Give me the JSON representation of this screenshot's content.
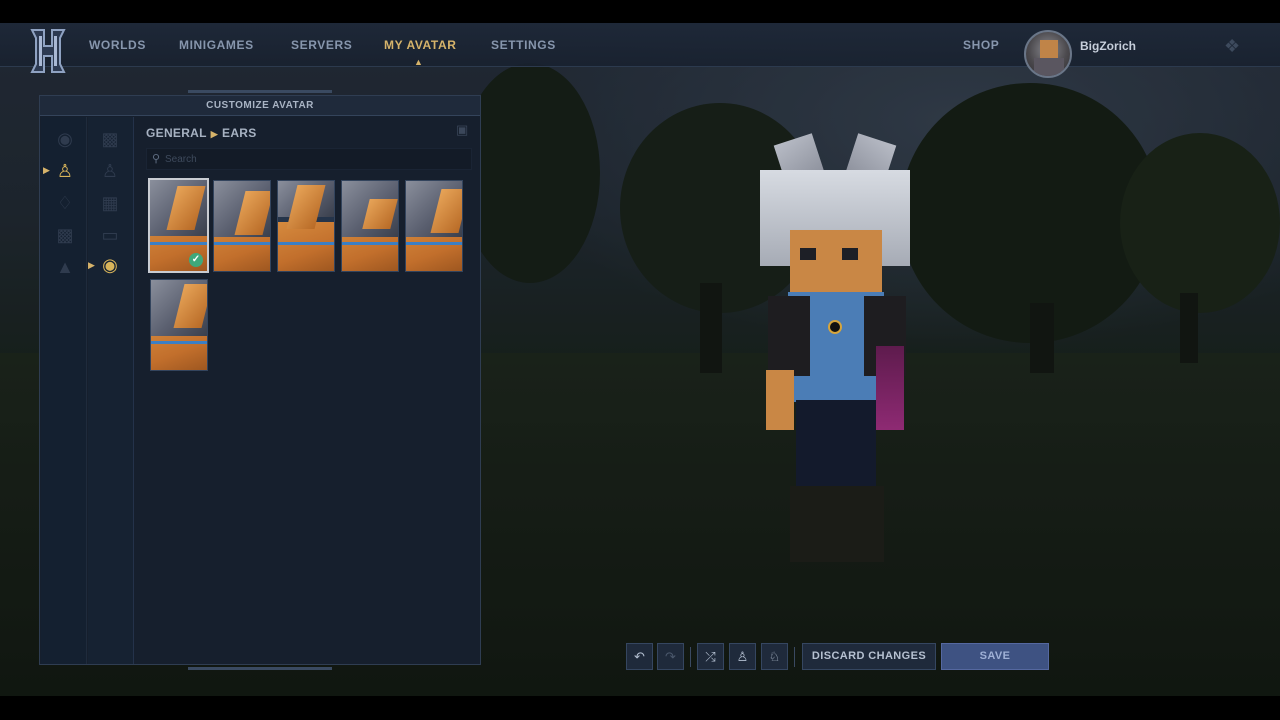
{
  "nav": {
    "items": [
      {
        "label": "WORLDS",
        "active": false
      },
      {
        "label": "MINIGAMES",
        "active": false
      },
      {
        "label": "SERVERS",
        "active": false
      },
      {
        "label": "MY AVATAR",
        "active": true
      },
      {
        "label": "SETTINGS",
        "active": false
      }
    ],
    "shop_label": "SHOP",
    "username": "BigZorich",
    "logo_icon": "hytale-h-logo",
    "accent_color": "#d6b36a"
  },
  "panel": {
    "title": "CUSTOMIZE AVATAR",
    "breadcrumb": {
      "parent": "GENERAL",
      "current": "EARS"
    },
    "search": {
      "placeholder": "Search",
      "value": ""
    },
    "categories_col1": [
      {
        "icon": "head-icon",
        "active": false
      },
      {
        "icon": "body-icon",
        "active": true
      },
      {
        "icon": "torso-icon",
        "active": false
      },
      {
        "icon": "legs-icon",
        "active": false
      },
      {
        "icon": "cape-icon",
        "active": false
      }
    ],
    "categories_col2": [
      {
        "icon": "bodytype-icon",
        "active": false
      },
      {
        "icon": "figure-icon",
        "active": false
      },
      {
        "icon": "face-icon",
        "active": false
      },
      {
        "icon": "mouth-icon",
        "active": false
      },
      {
        "icon": "ear-icon",
        "active": true
      }
    ],
    "ear_options": [
      {
        "name": "ears-option-1",
        "selected": true
      },
      {
        "name": "ears-option-2",
        "selected": false
      },
      {
        "name": "ears-option-3",
        "selected": false
      },
      {
        "name": "ears-option-4",
        "selected": false
      },
      {
        "name": "ears-option-5",
        "selected": false
      },
      {
        "name": "ears-option-6",
        "selected": false
      }
    ]
  },
  "toolbar": {
    "undo_icon": "undo-icon",
    "redo_icon": "redo-icon",
    "randomize_icon": "shuffle-icon",
    "pose_icon": "pose-icon",
    "character_icon": "character-swap-icon",
    "discard_label": "DISCARD CHANGES",
    "save_label": "SAVE"
  }
}
